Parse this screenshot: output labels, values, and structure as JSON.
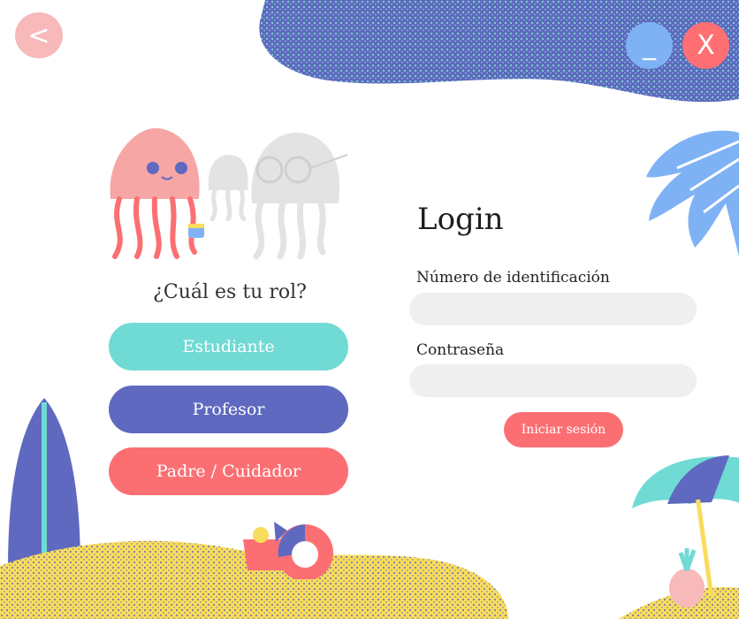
{
  "window": {
    "back_label": "<",
    "minimize_label": "_",
    "close_label": "X"
  },
  "role_panel": {
    "title": "¿Cuál es tu rol?",
    "roles": [
      {
        "label": "Estudiante"
      },
      {
        "label": "Profesor"
      },
      {
        "label": "Padre / Cuidador"
      }
    ]
  },
  "login": {
    "title": "Login",
    "id_label": "Número de identificación",
    "id_value": "",
    "password_label": "Contraseña",
    "password_value": "",
    "submit_label": "Iniciar sesión"
  },
  "colors": {
    "teal": "#70dad4",
    "indigo": "#5e69bf",
    "coral": "#fb6f73",
    "sand": "#f9dc5c",
    "field": "#efefef"
  }
}
